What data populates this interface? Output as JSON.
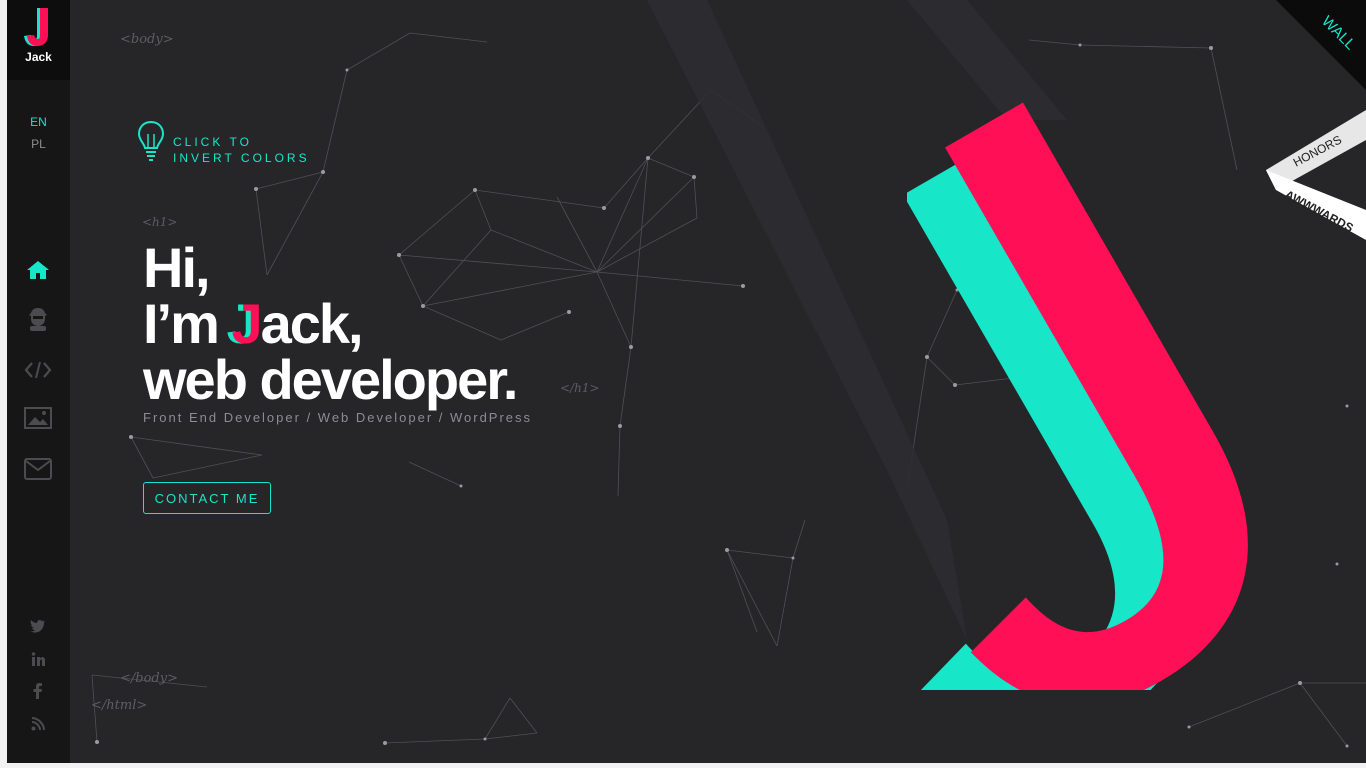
{
  "brand": {
    "name": "Jack",
    "accent": "#17e6c9",
    "accent2": "#ff0f55"
  },
  "languages": [
    {
      "label": "EN",
      "active": true
    },
    {
      "label": "PL",
      "active": false
    }
  ],
  "nav": [
    {
      "name": "home",
      "icon": "home-icon",
      "active": true
    },
    {
      "name": "about",
      "icon": "hacker-icon",
      "active": false
    },
    {
      "name": "code",
      "icon": "code-icon",
      "active": false
    },
    {
      "name": "portfolio",
      "icon": "image-icon",
      "active": false
    },
    {
      "name": "contact",
      "icon": "mail-icon",
      "active": false
    }
  ],
  "social": [
    {
      "name": "twitter",
      "icon": "twitter-icon"
    },
    {
      "name": "linkedin",
      "icon": "linkedin-icon"
    },
    {
      "name": "facebook",
      "icon": "facebook-icon"
    },
    {
      "name": "rss",
      "icon": "rss-icon"
    }
  ],
  "code_tags": {
    "body_open": "<body>",
    "h1_open": "<h1>",
    "h1_close": "</h1>",
    "body_close": "</body>",
    "html_close": "</html>"
  },
  "invert": {
    "line1": "CLICK TO",
    "line2": "INVERT COLORS"
  },
  "hero": {
    "line1": "Hi,",
    "line2_prefix": "I’m ",
    "line2_j": "J",
    "line2_rest": "ack,",
    "line3": "web developer."
  },
  "subtitle": "Front End Developer / Web Developer / WordPress",
  "contact_label": "CONTACT ME",
  "ribbon": {
    "wall": "WALL",
    "honors": "HONORS",
    "awwwards": "AWWWARDS"
  }
}
